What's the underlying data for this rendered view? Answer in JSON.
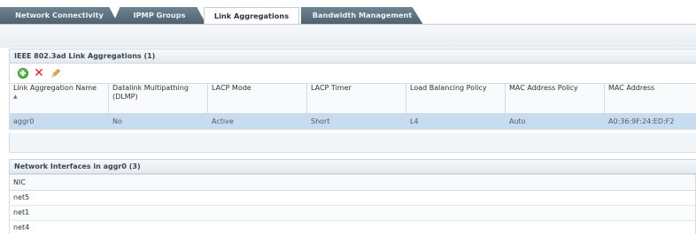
{
  "tabs": [
    {
      "label": "Network Connectivity",
      "active": false
    },
    {
      "label": "IPMP Groups",
      "active": false
    },
    {
      "label": "Link Aggregations",
      "active": true
    },
    {
      "label": "Bandwidth Management",
      "active": false
    }
  ],
  "aggregations": {
    "title": "IEEE 802.3ad Link Aggregations (1)",
    "toolbar": {
      "add": "add-icon",
      "delete": "delete-icon",
      "edit": "edit-icon"
    },
    "columns": [
      "Link Aggregation Name",
      "Datalink Multipathing (DLMP)",
      "LACP Mode",
      "LACP Timer",
      "Load Balancing Policy",
      "MAC Address Policy",
      "MAC Address"
    ],
    "rows": [
      [
        "aggr0",
        "No",
        "Active",
        "Short",
        "L4",
        "Auto",
        "A0:36:9F:24:ED:F2"
      ]
    ]
  },
  "interfaces": {
    "title": "Network Interfaces in aggr0 (3)",
    "columns": [
      "NIC"
    ],
    "rows": [
      [
        "net5"
      ],
      [
        "net1"
      ],
      [
        "net4"
      ]
    ]
  },
  "colors": {
    "tab_inactive": "#5e707c",
    "selected_row": "#c8dcf0",
    "delete_red": "#d9231a",
    "add_green": "#3aa52c"
  }
}
